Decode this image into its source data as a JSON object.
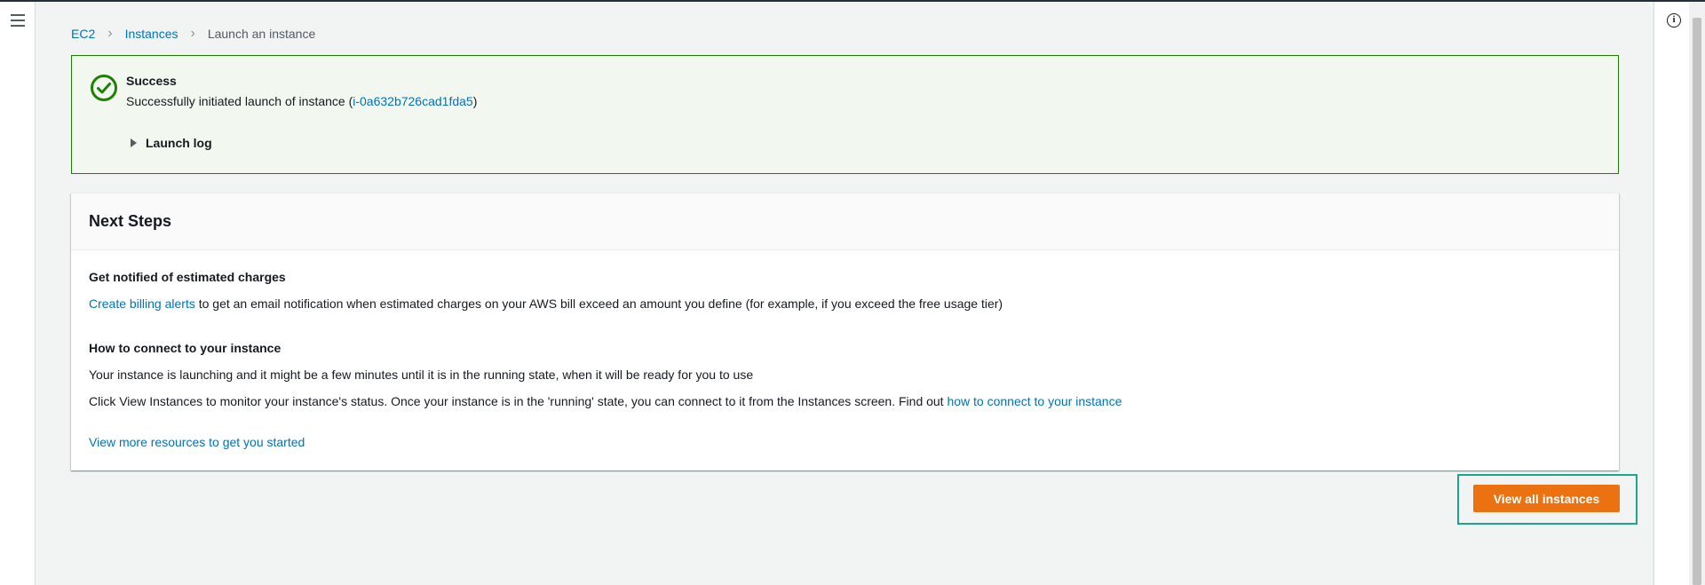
{
  "breadcrumb": {
    "items": [
      "EC2",
      "Instances"
    ],
    "current": "Launch an instance"
  },
  "flash": {
    "title": "Success",
    "message_prefix": "Successfully initiated launch of instance (",
    "instance_id": "i-0a632b726cad1fda5",
    "message_suffix": ")",
    "launch_log_label": "Launch log"
  },
  "next_steps": {
    "title": "Next Steps",
    "billing": {
      "heading": "Get notified of estimated charges",
      "link": "Create billing alerts",
      "text": " to get an email notification when estimated charges on your AWS bill exceed an amount you define (for example, if you exceed the free usage tier)"
    },
    "connect": {
      "heading": "How to connect to your instance",
      "line1": "Your instance is launching and it might be a few minutes until it is in the running state, when it will be ready for you to use",
      "line2_text": "Click View Instances to monitor your instance's status. Once your instance is in the 'running' state, you can connect to it from the Instances screen. Find out ",
      "line2_link": "how to connect to your instance"
    },
    "more_resources_link": "View more resources to get you started"
  },
  "actions": {
    "view_all_label": "View all instances"
  },
  "icons": {
    "menu": "hamburger-menu-icon",
    "info": "info-icon",
    "success": "check-circle-icon",
    "caret": "caret-right-icon"
  },
  "colors": {
    "success_green": "#1d8102",
    "link_blue": "#0073bb",
    "primary_orange": "#ec7211",
    "highlight_teal": "#1aa58c"
  }
}
